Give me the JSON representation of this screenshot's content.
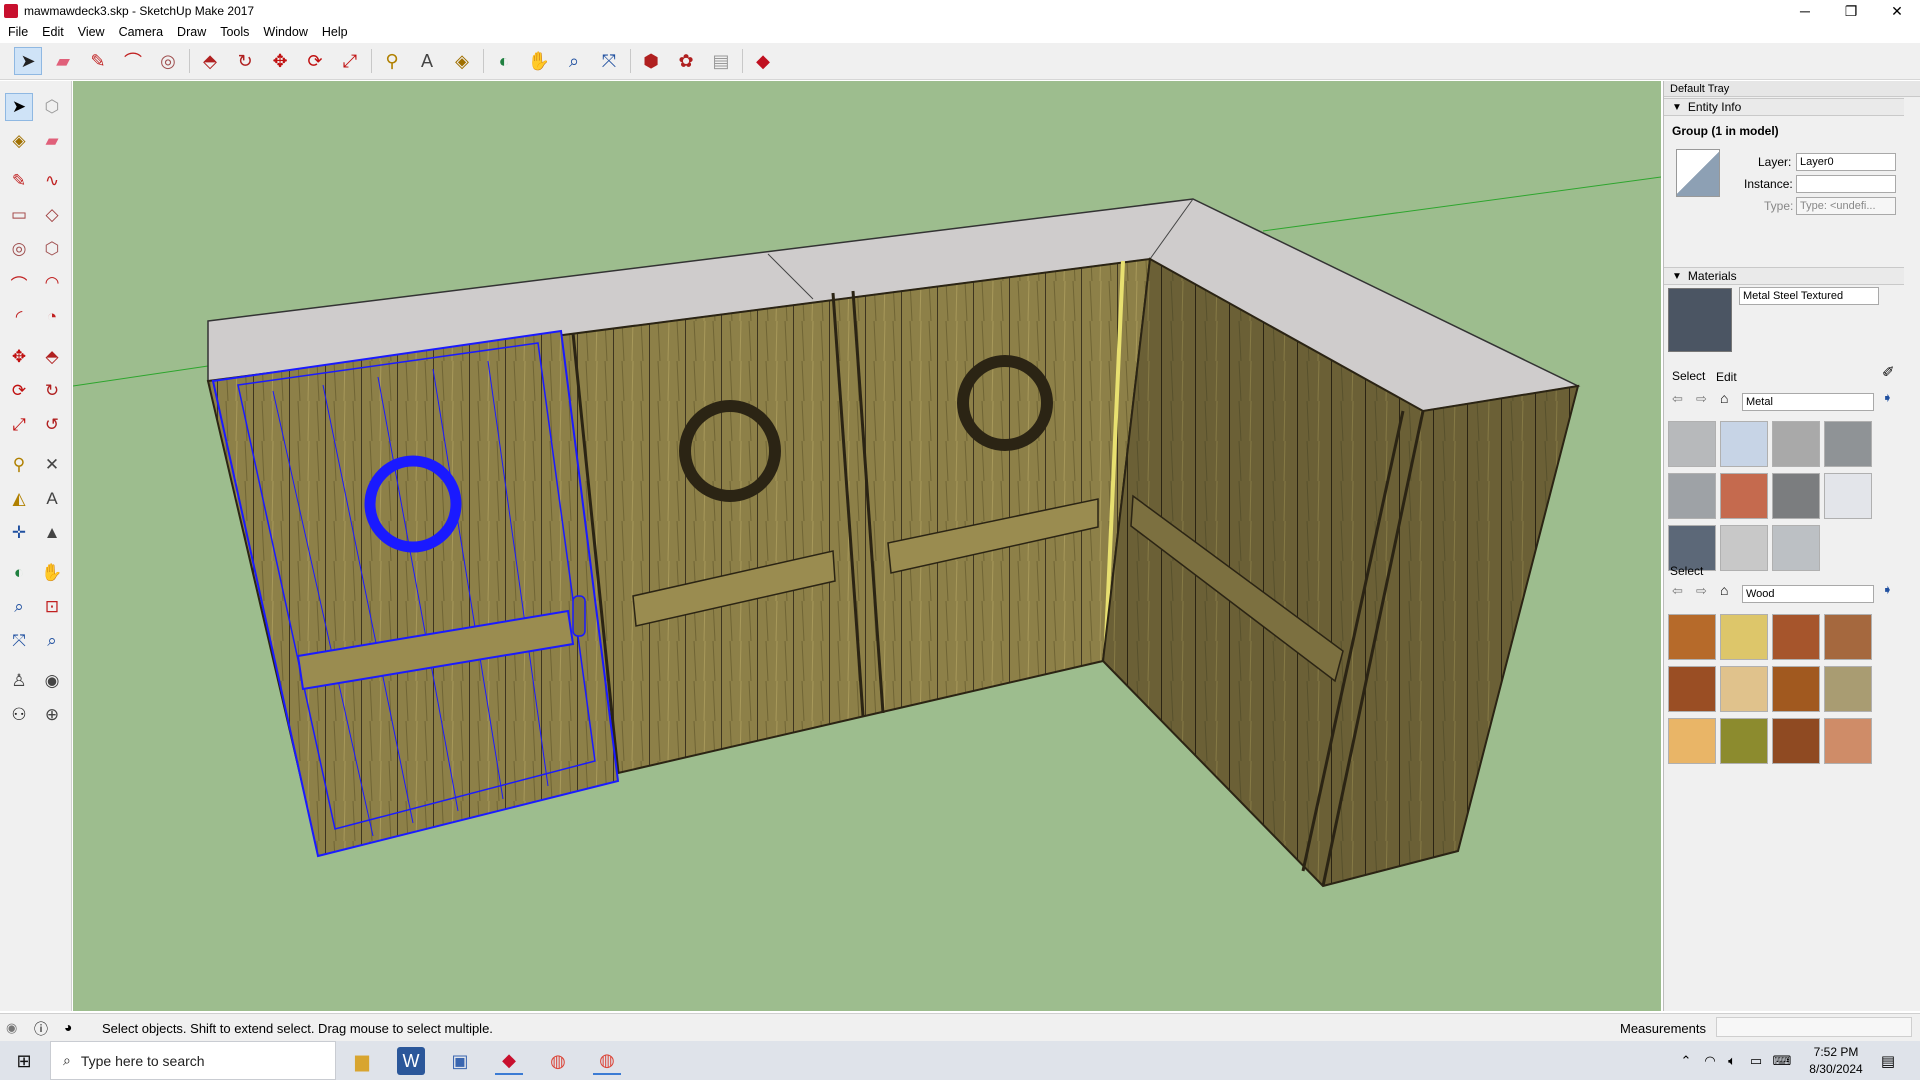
{
  "window": {
    "title": "mawmawdeck3.skp - SketchUp Make 2017",
    "minimize": "─",
    "restore": "❐",
    "close": "✕"
  },
  "menu": [
    "File",
    "Edit",
    "View",
    "Camera",
    "Draw",
    "Tools",
    "Window",
    "Help"
  ],
  "tray": {
    "title": "Default Tray",
    "entity_info": {
      "header": "Entity Info",
      "selection": "Group (1 in model)",
      "layer_label": "Layer:",
      "layer_value": "Layer0",
      "instance_label": "Instance:",
      "instance_value": "",
      "type_label": "Type:",
      "type_value": "Type: <undefi..."
    },
    "materials": {
      "header": "Materials",
      "current_name": "Metal Steel Textured",
      "tab_select": "Select",
      "tab_edit": "Edit",
      "library_1": "Metal",
      "select_label": "Select",
      "library_2": "Wood",
      "metal_swatches": [
        "#b7b9bb",
        "#c7d4e6",
        "#a9a9a9",
        "#8f9396",
        "#9ea2a6",
        "#c56a4e",
        "#7b7d7f",
        "#e3e5ea",
        "#5c6878",
        "#c8c8c8",
        "#bcc0c4"
      ],
      "wood_swatches": [
        "#b66a2a",
        "#ddc66a",
        "#a6552c",
        "#a5683e",
        "#9a4e24",
        "#e0c28c",
        "#a1591f",
        "#a99c72",
        "#e9b567",
        "#8c8b2e",
        "#8f4a22",
        "#cf8c68"
      ]
    }
  },
  "status": {
    "message": "Select objects. Shift to extend select. Drag mouse to select multiple.",
    "measurements_label": "Measurements",
    "measurements_value": ""
  },
  "taskbar": {
    "search_placeholder": "Type here to search",
    "time": "7:52 PM",
    "date": "8/30/2024"
  }
}
